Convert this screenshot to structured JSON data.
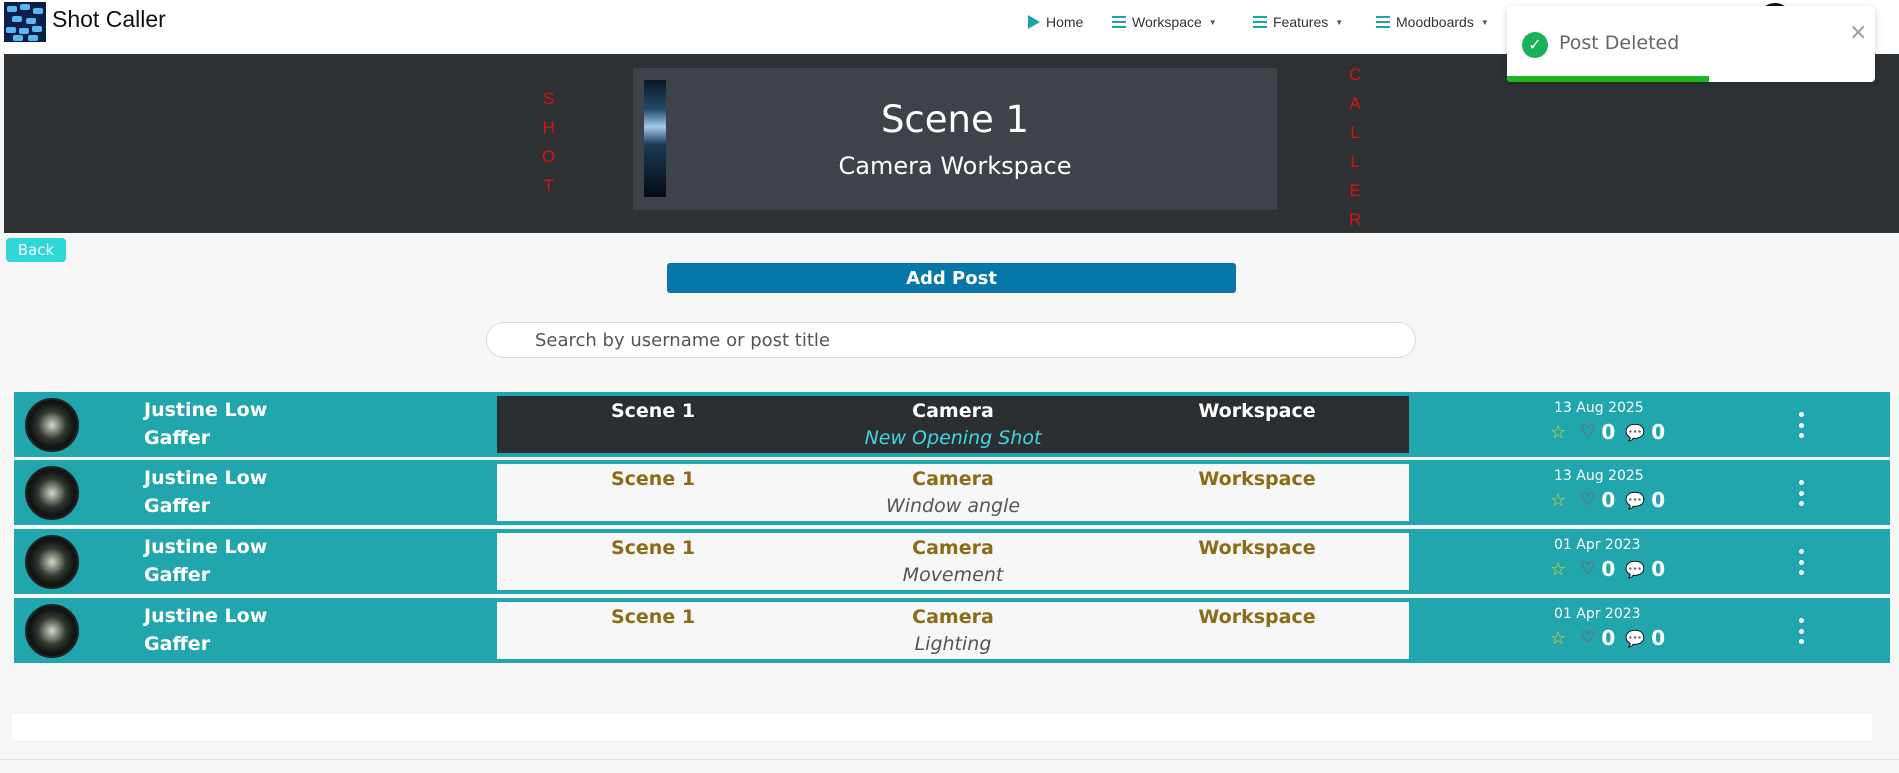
{
  "app": {
    "brand": "Shot Caller"
  },
  "nav": {
    "home": "Home",
    "workspace": "Workspace",
    "features": "Features",
    "moodboards": "Moodboards"
  },
  "hero": {
    "left_word": [
      "S",
      "H",
      "O",
      "T"
    ],
    "right_word": [
      "C",
      "A",
      "L",
      "L",
      "E",
      "R"
    ],
    "title": "Scene 1",
    "subtitle": "Camera Workspace"
  },
  "controls": {
    "back": "Back",
    "add_post": "Add Post",
    "search_placeholder": "Search by username or post title"
  },
  "posts": [
    {
      "name": "Justine Low",
      "role": "Gaffer",
      "scene": "Scene 1",
      "department": "Camera",
      "space": "Workspace",
      "title": "New Opening Shot",
      "date": "13 Aug 2025",
      "likes": "0",
      "comments": "0",
      "active": true
    },
    {
      "name": "Justine Low",
      "role": "Gaffer",
      "scene": "Scene 1",
      "department": "Camera",
      "space": "Workspace",
      "title": "Window angle",
      "date": "13 Aug 2025",
      "likes": "0",
      "comments": "0",
      "active": false
    },
    {
      "name": "Justine Low",
      "role": "Gaffer",
      "scene": "Scene 1",
      "department": "Camera",
      "space": "Workspace",
      "title": "Movement",
      "date": "01 Apr 2023",
      "likes": "0",
      "comments": "0",
      "active": false
    },
    {
      "name": "Justine Low",
      "role": "Gaffer",
      "scene": "Scene 1",
      "department": "Camera",
      "space": "Workspace",
      "title": "Lighting",
      "date": "01 Apr 2023",
      "likes": "0",
      "comments": "0",
      "active": false
    }
  ],
  "toast": {
    "message": "Post Deleted",
    "progress": 0.55
  },
  "colors": {
    "accent": "#22a6ae",
    "brand_blue": "#0776a8",
    "hero_bg": "#2e3234",
    "toast_green": "#1fb61f",
    "highlight_red": "#e01010"
  }
}
